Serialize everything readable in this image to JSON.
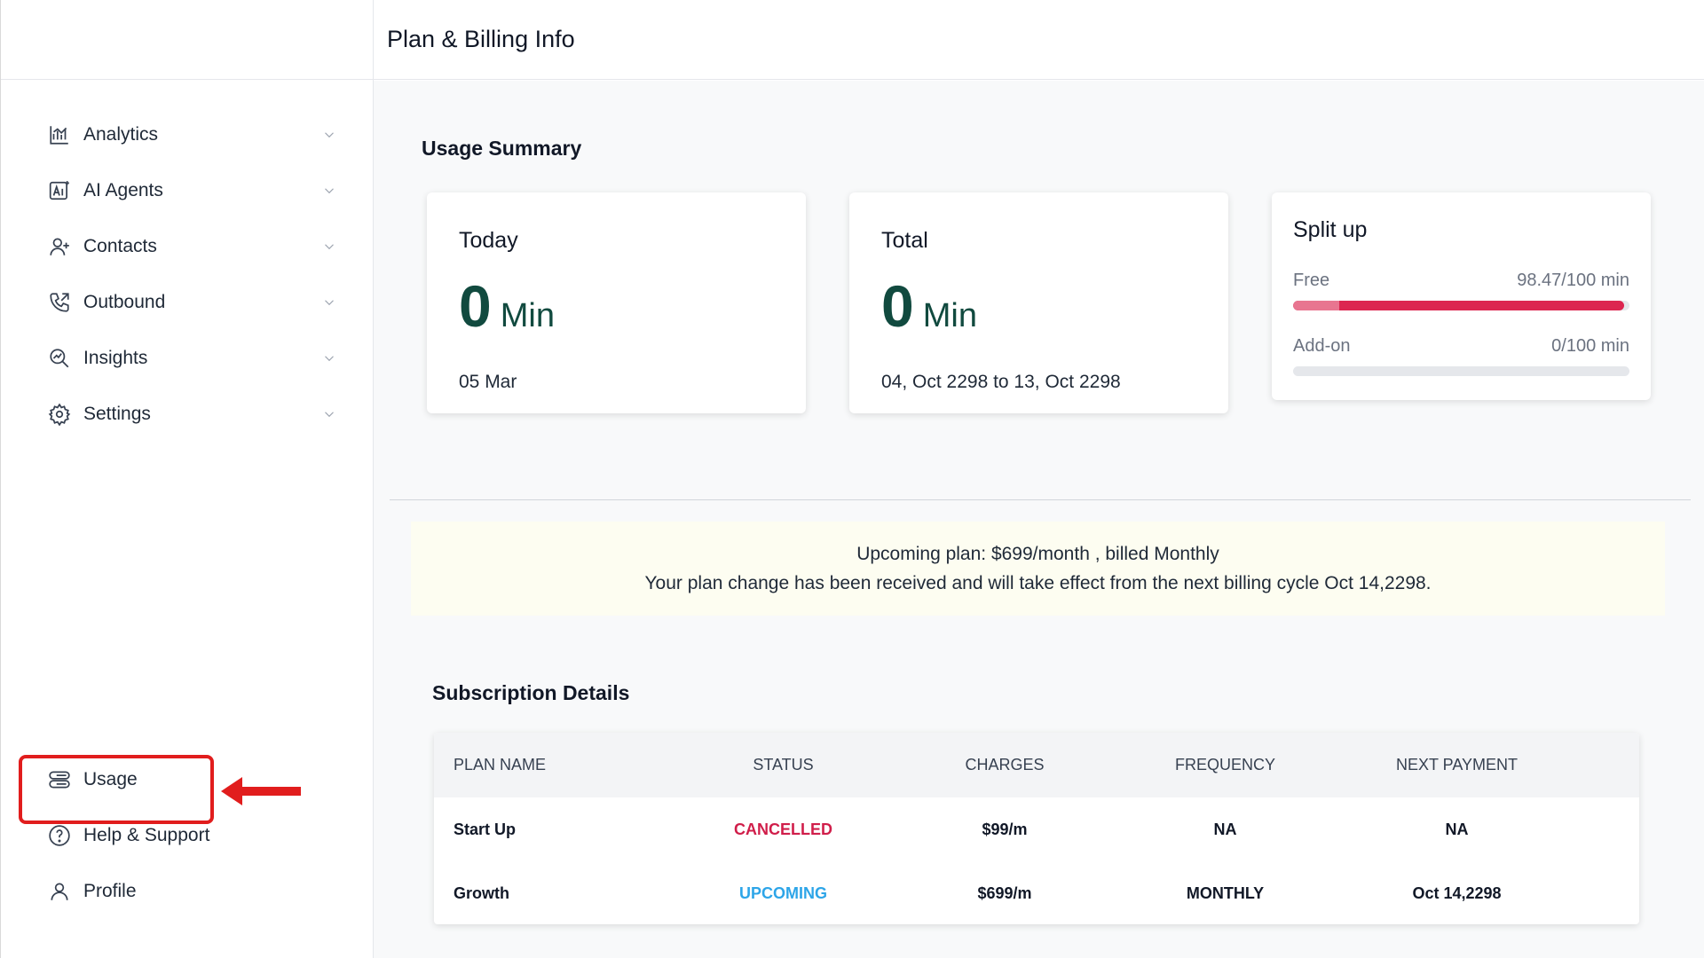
{
  "header": {
    "title": "Plan & Billing Info"
  },
  "sidebar": {
    "items": [
      {
        "label": "Analytics",
        "icon": "analytics-icon"
      },
      {
        "label": "AI Agents",
        "icon": "ai-agents-icon"
      },
      {
        "label": "Contacts",
        "icon": "contacts-icon"
      },
      {
        "label": "Outbound",
        "icon": "outbound-phone-icon"
      },
      {
        "label": "Insights",
        "icon": "insights-icon"
      },
      {
        "label": "Settings",
        "icon": "settings-gear-icon"
      }
    ],
    "bottom_items": [
      {
        "label": "Usage",
        "icon": "usage-icon"
      },
      {
        "label": "Help & Support",
        "icon": "help-icon"
      },
      {
        "label": "Profile",
        "icon": "profile-icon"
      }
    ]
  },
  "usage_summary": {
    "title": "Usage Summary",
    "today": {
      "title": "Today",
      "value": "0",
      "unit": "Min",
      "sub": "05 Mar"
    },
    "total": {
      "title": "Total",
      "value": "0",
      "unit": "Min",
      "sub": "04, Oct 2298 to 13, Oct 2298"
    },
    "split": {
      "title": "Split up",
      "free": {
        "label": "Free",
        "value": "98.47/100 min",
        "fraction": 0.9847
      },
      "addon": {
        "label": "Add-on",
        "value": "0/100 min",
        "fraction": 0
      }
    }
  },
  "notice": {
    "line1": "Upcoming plan: $699/month , billed Monthly",
    "line2": "Your plan change has been received and will take effect from the next billing cycle Oct 14,2298."
  },
  "subscription": {
    "title": "Subscription Details",
    "columns": [
      "PLAN NAME",
      "STATUS",
      "CHARGES",
      "FREQUENCY",
      "NEXT PAYMENT"
    ],
    "rows": [
      {
        "plan": "Start Up",
        "status": "CANCELLED",
        "charges": "$99/m",
        "frequency": "NA",
        "next": "NA"
      },
      {
        "plan": "Growth",
        "status": "UPCOMING",
        "charges": "$699/m",
        "frequency": "MONTHLY",
        "next": "Oct 14,2298"
      }
    ]
  },
  "colors": {
    "accent_dark_green": "#114a3f",
    "cancelled": "#d01e4a",
    "upcoming": "#2da5e8",
    "highlight_red": "#e11d1d",
    "progress": "#dc2650"
  }
}
